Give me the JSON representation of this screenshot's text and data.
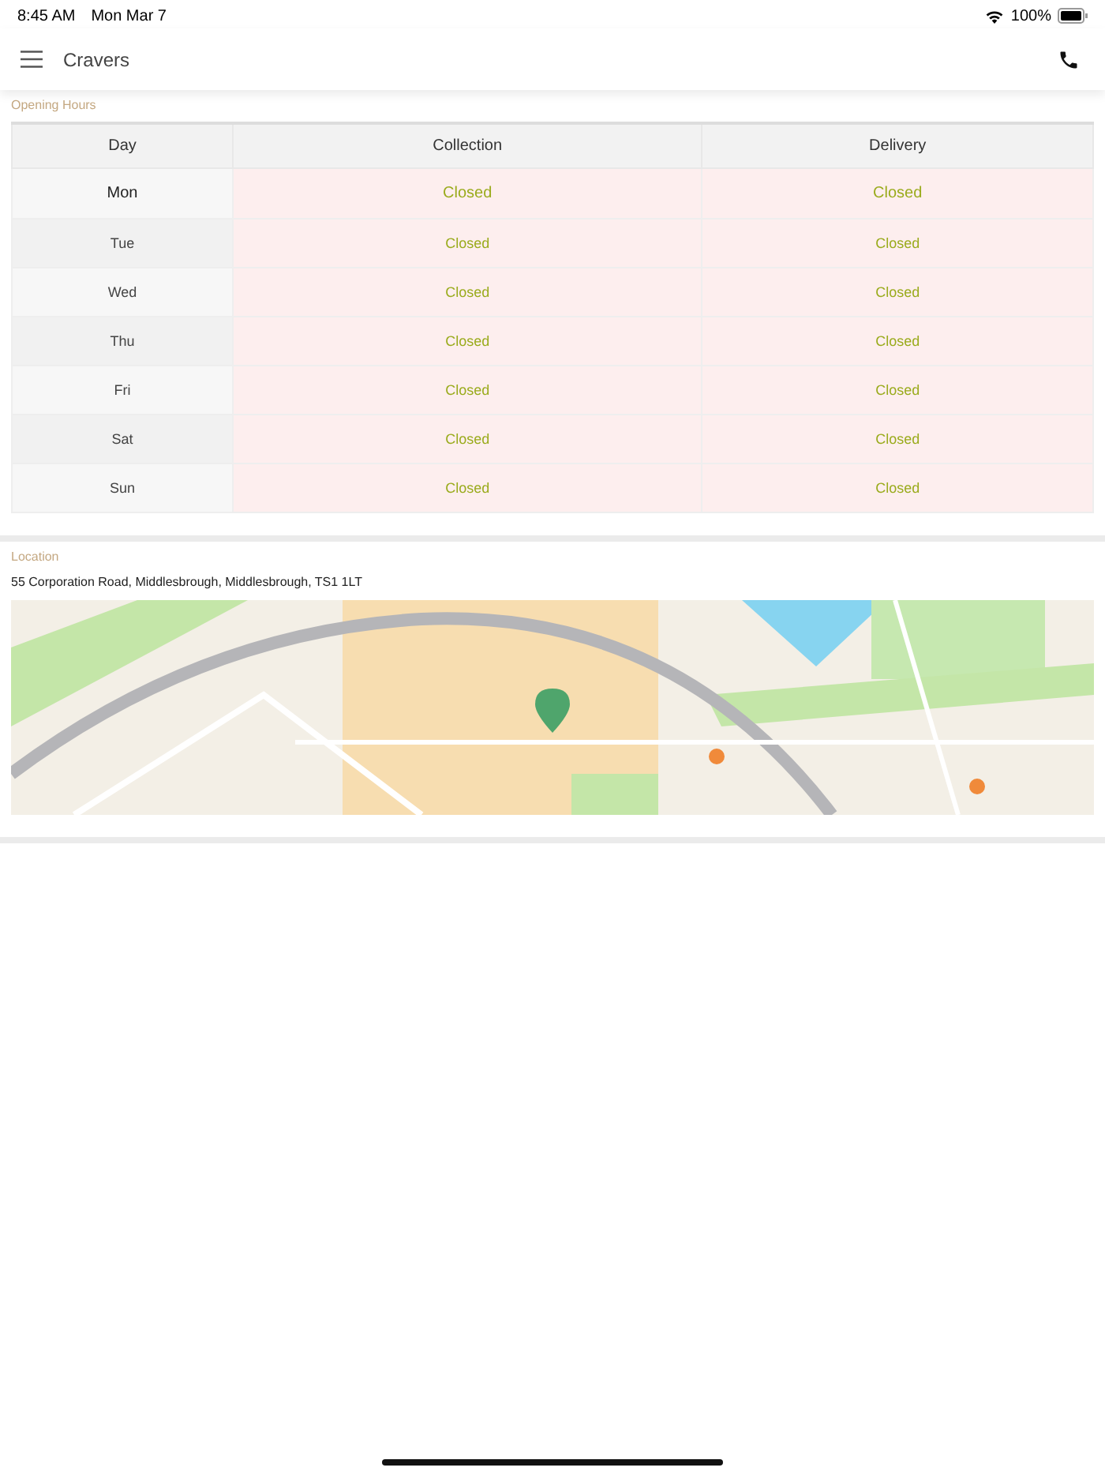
{
  "status_bar": {
    "time": "8:45 AM",
    "date": "Mon Mar 7",
    "battery": "100%"
  },
  "nav_bar": {
    "title": "Cravers"
  },
  "opening_hours": {
    "heading": "Opening Hours",
    "columns": [
      "Day",
      "Collection",
      "Delivery"
    ],
    "rows": [
      {
        "day": "Mon",
        "collection": "Closed",
        "delivery": "Closed",
        "selected": true
      },
      {
        "day": "Tue",
        "collection": "Closed",
        "delivery": "Closed",
        "selected": false
      },
      {
        "day": "Wed",
        "collection": "Closed",
        "delivery": "Closed",
        "selected": false
      },
      {
        "day": "Thu",
        "collection": "Closed",
        "delivery": "Closed",
        "selected": false
      },
      {
        "day": "Fri",
        "collection": "Closed",
        "delivery": "Closed",
        "selected": false
      },
      {
        "day": "Sat",
        "collection": "Closed",
        "delivery": "Closed",
        "selected": false
      },
      {
        "day": "Sun",
        "collection": "Closed",
        "delivery": "Closed",
        "selected": false
      }
    ]
  },
  "location": {
    "heading": "Location",
    "address": "55 Corporation Road, Middlesbrough, Middlesbrough, TS1 1LT"
  }
}
